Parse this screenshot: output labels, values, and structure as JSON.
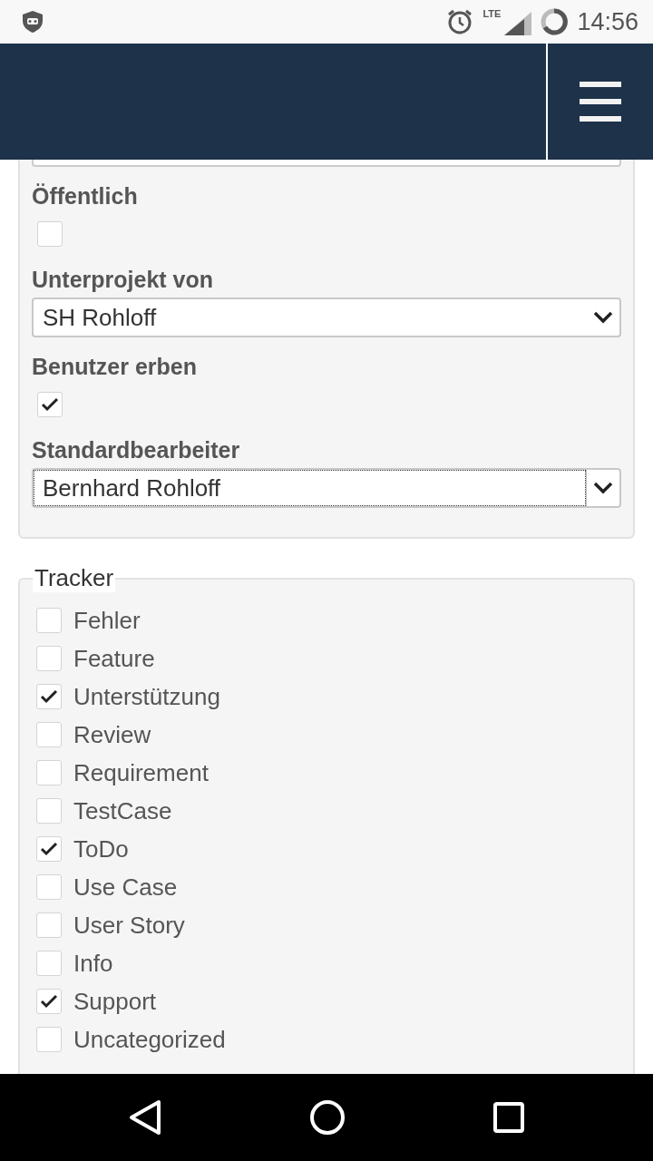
{
  "status_bar": {
    "network": "LTE",
    "time": "14:56"
  },
  "form": {
    "fields": [
      {
        "kind": "checkbox",
        "label": "Öffentlich",
        "checked": false
      },
      {
        "kind": "select",
        "label": "Unterprojekt von",
        "value": "SH Rohloff",
        "focused": false
      },
      {
        "kind": "checkbox",
        "label": "Benutzer erben",
        "checked": true
      },
      {
        "kind": "select",
        "label": "Standardbearbeiter",
        "value": "Bernhard Rohloff",
        "focused": true
      }
    ]
  },
  "tracker": {
    "legend": "Tracker",
    "items": [
      {
        "label": "Fehler",
        "checked": false
      },
      {
        "label": "Feature",
        "checked": false
      },
      {
        "label": "Unterstützung",
        "checked": true
      },
      {
        "label": "Review",
        "checked": false
      },
      {
        "label": "Requirement",
        "checked": false
      },
      {
        "label": "TestCase",
        "checked": false
      },
      {
        "label": "ToDo",
        "checked": true
      },
      {
        "label": "Use Case",
        "checked": false
      },
      {
        "label": "User Story",
        "checked": false
      },
      {
        "label": "Info",
        "checked": false
      },
      {
        "label": "Support",
        "checked": true
      },
      {
        "label": "Uncategorized",
        "checked": false
      }
    ]
  }
}
